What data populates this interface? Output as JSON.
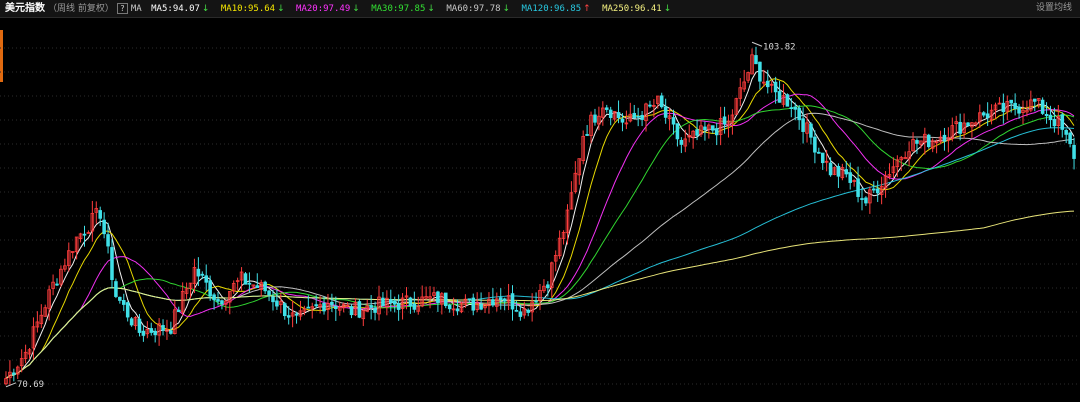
{
  "header": {
    "title": "美元指数",
    "subtitle": "（周线 前复权）",
    "help_label": "?",
    "ma_label": "MA",
    "settings_label": "设置均线"
  },
  "moving_averages": [
    {
      "name": "MA5",
      "value": "94.07",
      "trend": "↓",
      "color": "#ffffff"
    },
    {
      "name": "MA10",
      "value": "95.64",
      "trend": "↓",
      "color": "#f4e500"
    },
    {
      "name": "MA20",
      "value": "97.49",
      "trend": "↓",
      "color": "#ff33ff"
    },
    {
      "name": "MA30",
      "value": "97.85",
      "trend": "↓",
      "color": "#33e033"
    },
    {
      "name": "MA60",
      "value": "97.78",
      "trend": "↓",
      "color": "#c8c8c8"
    },
    {
      "name": "MA120",
      "value": "96.85",
      "trend": "↑",
      "color": "#28c8e0"
    },
    {
      "name": "MA250",
      "value": "96.41",
      "trend": "↓",
      "color": "#f4f080"
    }
  ],
  "chart_data": {
    "type": "candlestick",
    "symbol": "美元指数",
    "period": "周线",
    "high_marker": "103.82",
    "low_marker": "70.69",
    "ylim": [
      70,
      105
    ],
    "keypoints_close": [
      [
        0,
        71.5
      ],
      [
        5,
        74
      ],
      [
        12,
        80.5
      ],
      [
        18,
        85
      ],
      [
        24,
        87.5
      ],
      [
        28,
        79.5
      ],
      [
        34,
        76
      ],
      [
        42,
        76.5
      ],
      [
        48,
        82
      ],
      [
        54,
        79
      ],
      [
        60,
        81
      ],
      [
        66,
        80
      ],
      [
        74,
        77
      ],
      [
        82,
        79
      ],
      [
        88,
        78
      ],
      [
        94,
        78.5
      ],
      [
        102,
        78.8
      ],
      [
        110,
        79.2
      ],
      [
        118,
        78.5
      ],
      [
        126,
        79.5
      ],
      [
        132,
        78
      ],
      [
        138,
        81
      ],
      [
        143,
        87
      ],
      [
        147,
        95
      ],
      [
        152,
        98
      ],
      [
        158,
        96
      ],
      [
        166,
        98
      ],
      [
        172,
        94
      ],
      [
        178,
        95.2
      ],
      [
        184,
        96
      ],
      [
        190,
        102
      ],
      [
        195,
        99
      ],
      [
        200,
        98
      ],
      [
        206,
        94
      ],
      [
        210,
        91.5
      ],
      [
        214,
        91
      ],
      [
        219,
        88.5
      ],
      [
        224,
        91
      ],
      [
        230,
        94
      ],
      [
        236,
        94.5
      ],
      [
        244,
        96
      ],
      [
        250,
        97
      ],
      [
        256,
        97.5
      ],
      [
        262,
        98
      ],
      [
        268,
        96
      ],
      [
        272,
        93
      ]
    ],
    "note": "Weekly US Dollar Index candlestick chart with 7 moving averages; close values approximated from chart shape."
  }
}
